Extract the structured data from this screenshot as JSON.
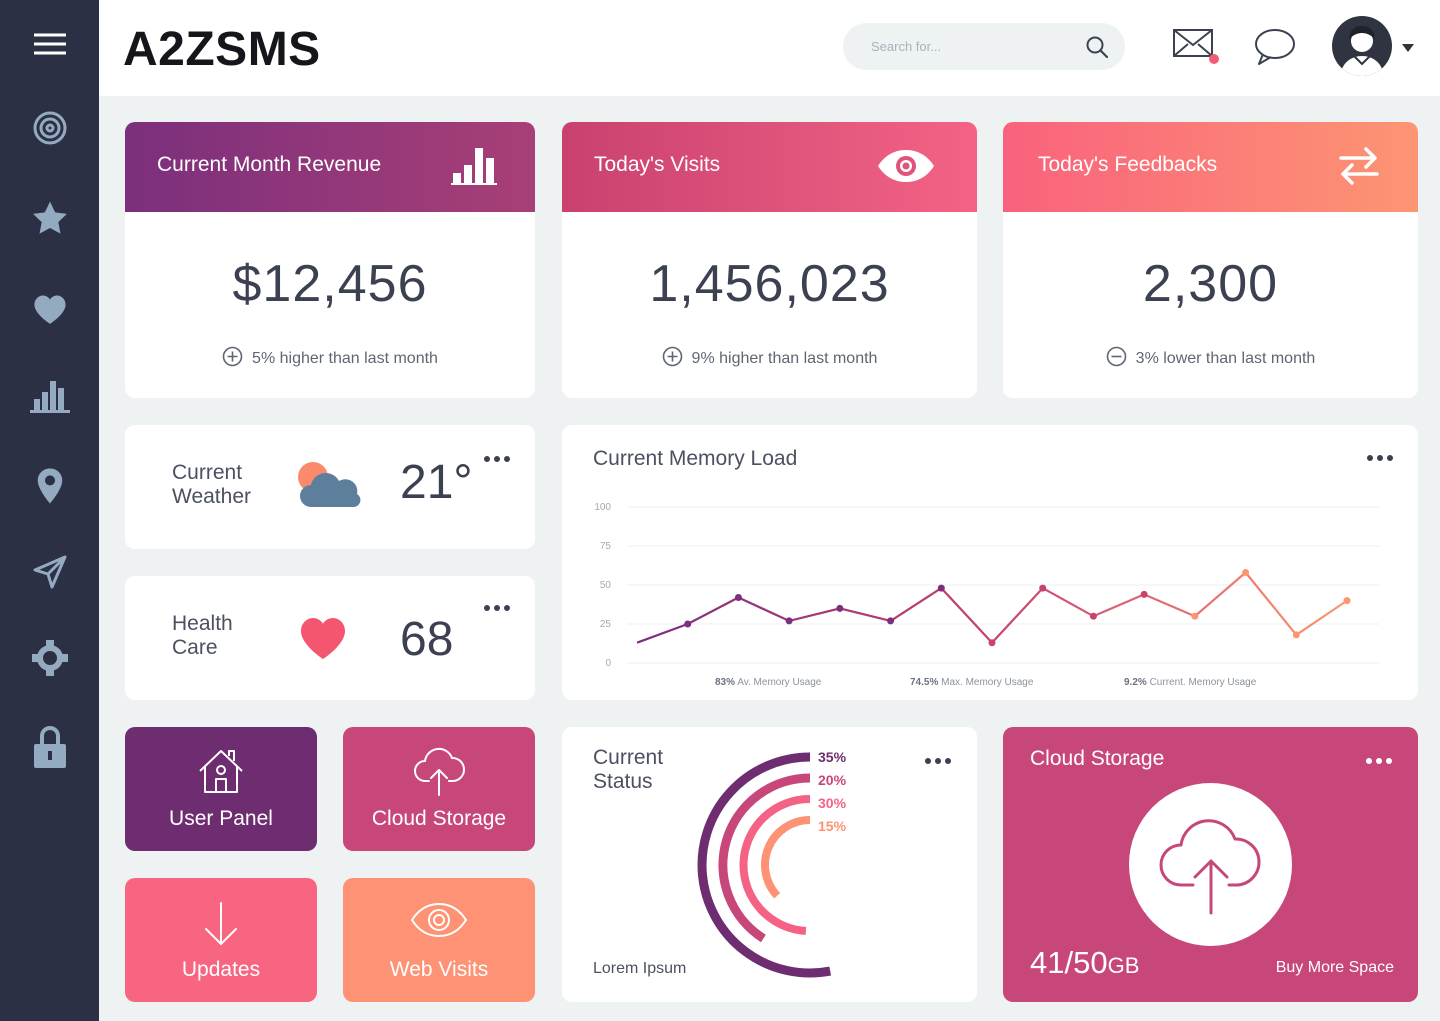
{
  "app": {
    "brand": "A2ZSMS"
  },
  "search": {
    "placeholder": "Search for..."
  },
  "sidebar": {
    "items": [
      {
        "icon": "menu-icon"
      },
      {
        "icon": "target-icon"
      },
      {
        "icon": "star-icon"
      },
      {
        "icon": "heart-icon"
      },
      {
        "icon": "bar-chart-icon"
      },
      {
        "icon": "location-pin-icon"
      },
      {
        "icon": "send-icon"
      },
      {
        "icon": "settings-icon"
      },
      {
        "icon": "lock-icon"
      }
    ]
  },
  "stats": [
    {
      "title": "Current Month Revenue",
      "value": "$12,456",
      "note": "5% higher than last month",
      "trend": "up",
      "icon": "bar-chart-icon",
      "color_from": "#7b2f7c",
      "color_to": "#a83f77"
    },
    {
      "title": "Today's Visits",
      "value": "1,456,023",
      "note": "9% higher than last month",
      "trend": "up",
      "icon": "eye-icon",
      "color_from": "#c8416f",
      "color_to": "#f46385"
    },
    {
      "title": "Today's Feedbacks",
      "value": "2,300",
      "note": "3% lower than last month",
      "trend": "down",
      "icon": "swap-arrows-icon",
      "color_from": "#f9627d",
      "color_to": "#fd9573"
    }
  ],
  "weather": {
    "label": "Current Weather",
    "value": "21°",
    "icon": "partly-cloudy-icon"
  },
  "health": {
    "label": "Health Care",
    "value": "68",
    "icon": "heart-icon"
  },
  "memory": {
    "title": "Current Memory Load",
    "stats": [
      {
        "value": "83%",
        "label": "Av. Memory Usage"
      },
      {
        "value": "74.5%",
        "label": "Max. Memory Usage"
      },
      {
        "value": "9.2%",
        "label": "Current. Memory Usage"
      }
    ]
  },
  "chart_data": {
    "type": "line",
    "title": "Current Memory Load",
    "ylim": [
      0,
      100
    ],
    "yticks": [
      0,
      25,
      50,
      75,
      100
    ],
    "grid": true,
    "series": [
      {
        "values": [
          13,
          25,
          42,
          27,
          35,
          27,
          48,
          13,
          48,
          30,
          44,
          30,
          58,
          18,
          40
        ]
      }
    ],
    "colors": {
      "start": "#7b2f7c",
      "mid": "#c8416f",
      "end": "#fd9573"
    }
  },
  "tiles": [
    {
      "label": "User Panel",
      "icon": "home-icon",
      "color": "#6e2d70"
    },
    {
      "label": "Cloud Storage",
      "icon": "cloud-upload-icon",
      "color": "#c8477a"
    },
    {
      "label": "Updates",
      "icon": "arrow-down-icon",
      "color": "#f76580"
    },
    {
      "label": "Web Visits",
      "icon": "eye-icon",
      "color": "#fd9274"
    }
  ],
  "status": {
    "title": "Current Status",
    "footer": "Lorem Ipsum",
    "rings": [
      {
        "label": "35%",
        "percent": 35,
        "color": "#6e2d70"
      },
      {
        "label": "20%",
        "percent": 20,
        "color": "#c8477a"
      },
      {
        "label": "30%",
        "percent": 30,
        "color": "#f46385"
      },
      {
        "label": "15%",
        "percent": 15,
        "color": "#fd9274"
      }
    ]
  },
  "cloud": {
    "title": "Cloud Storage",
    "used": "41/50",
    "unit": "GB",
    "action": "Buy More Space",
    "color": "#c8477a"
  }
}
